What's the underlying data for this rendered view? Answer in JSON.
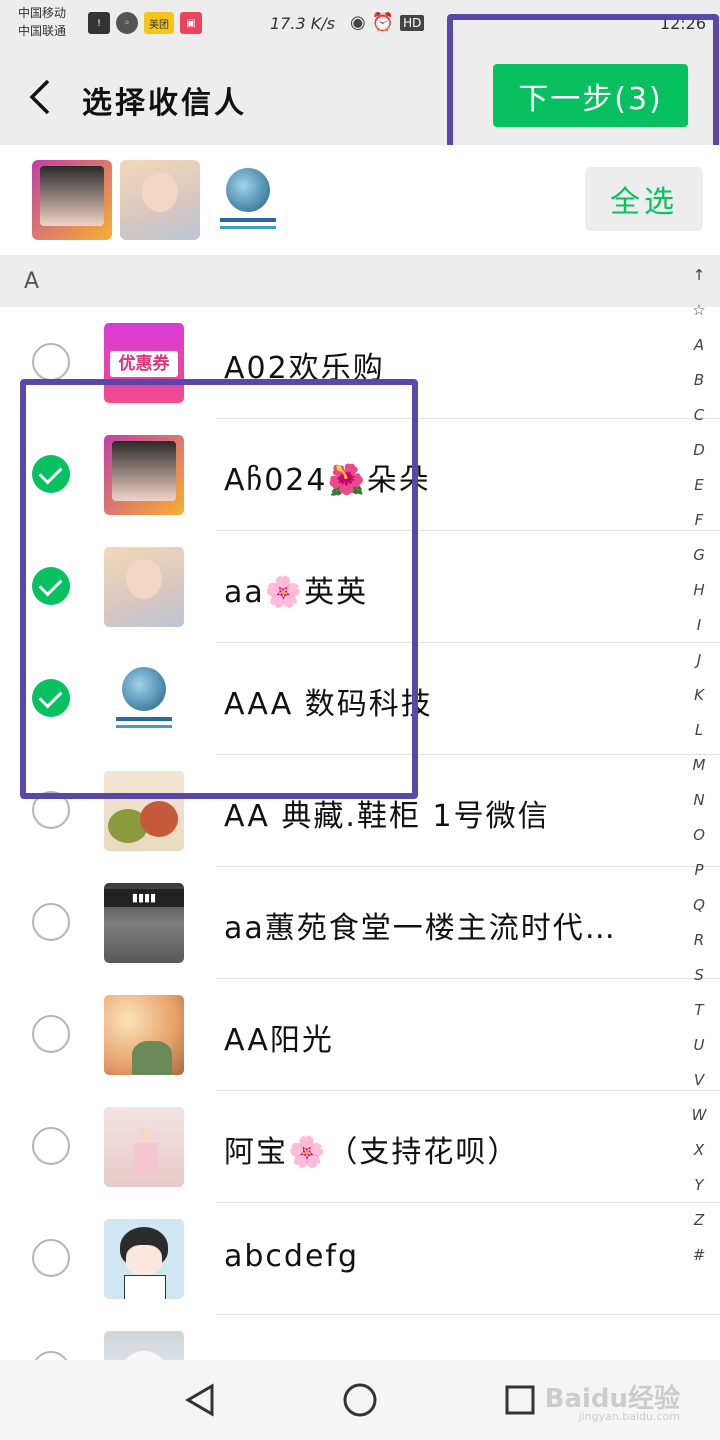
{
  "status_bar": {
    "carrier_line1": "中国移动",
    "carrier_line2": "中国联通",
    "app_badge": "美团",
    "speed": "17.3 K/s",
    "hd": "HD",
    "time": "12:26"
  },
  "header": {
    "back_icon": "chevron-left-icon",
    "title": "选择收信人",
    "next_label": "下一步(3)"
  },
  "selected_bar": {
    "select_all_label": "全选",
    "avatars": [
      "avatar-girl-pink",
      "avatar-girl-blonde",
      "avatar-globe"
    ]
  },
  "section": {
    "letter": "A"
  },
  "contacts": [
    {
      "name": "A02欢乐购",
      "checked": false,
      "avatar": "coupon"
    },
    {
      "name": "Aჩ024🌺朵朵",
      "checked": true,
      "avatar": "girl-pink"
    },
    {
      "name": "aa🌸英英",
      "checked": true,
      "avatar": "girl-blonde"
    },
    {
      "name": "AAA 数码科技",
      "checked": true,
      "avatar": "globe"
    },
    {
      "name": "AA 典藏.鞋柜 1号微信",
      "checked": false,
      "avatar": "knit"
    },
    {
      "name": "aa蕙苑食堂一楼主流时代…",
      "checked": false,
      "avatar": "shop"
    },
    {
      "name": "AA阳光",
      "checked": false,
      "avatar": "sunny"
    },
    {
      "name": "阿宝🌸（支持花呗）",
      "checked": false,
      "avatar": "pink-room"
    },
    {
      "name": "abcdefg",
      "checked": false,
      "avatar": "anime-boy"
    },
    {
      "name": "",
      "checked": false,
      "avatar": "cat"
    }
  ],
  "index_letters": [
    "↑",
    "☆",
    "A",
    "B",
    "C",
    "D",
    "E",
    "F",
    "G",
    "H",
    "I",
    "J",
    "K",
    "L",
    "M",
    "N",
    "O",
    "P",
    "Q",
    "R",
    "S",
    "T",
    "U",
    "V",
    "W",
    "X",
    "Y",
    "Z",
    "#"
  ],
  "nav": {
    "back_icon": "triangle-back-icon",
    "home_icon": "circle-home-icon",
    "recent_icon": "square-recent-icon"
  },
  "watermark": {
    "text": "Baidu经验",
    "sub": "jingyan.baidu.com"
  },
  "colors": {
    "accent": "#07c160",
    "highlight": "#5b47a8",
    "background": "#ededed"
  }
}
